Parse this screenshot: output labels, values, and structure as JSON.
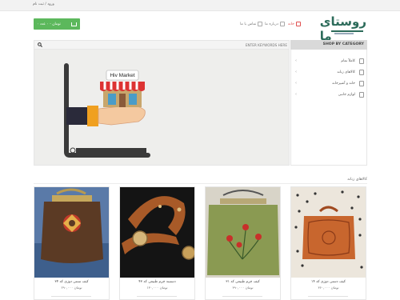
{
  "topbar": {
    "login_text": "ورود / ثبت نام"
  },
  "header": {
    "cart_label": "۰ تومان - ۰ عدد",
    "nav": {
      "home": "خانه",
      "about": "درباره ما",
      "contact": "تماس با ما"
    },
    "logo_text": "روستای ما"
  },
  "search": {
    "placeholder": "ENTER KEYWORDS HERE"
  },
  "categories": {
    "heading": "SHOP BY CATEGORY",
    "items": [
      {
        "label": "کاملاً تمام",
        "icon": "bag-icon"
      },
      {
        "label": "کالاهای زنانه",
        "icon": "dress-icon"
      },
      {
        "label": "خانه و آشپزخانه",
        "icon": "home-icon"
      },
      {
        "label": "لوازم جانبی",
        "icon": "gift-icon"
      }
    ]
  },
  "banner": {
    "sign_text": "Hiv Market"
  },
  "section": {
    "title": "کالاهای زنانه"
  },
  "products": [
    {
      "name": "کیف دستی دوزی کد ۱۴",
      "price": "۳۶۰,۰۰۰ تومان"
    },
    {
      "name": "کیف چرم طبیعی کد ۳۱",
      "price": "۳۹۰,۰۰۰ تومان"
    },
    {
      "name": "دستبند چرم طبیعی کد ۴۳",
      "price": "۱۳۰,۰۰۰ تومان"
    },
    {
      "name": "کیف سنتی دوزی کد ۳۴",
      "price": "۲۹۰,۰۰۰ تومان"
    }
  ],
  "colors": {
    "accent": "#5cb85c",
    "home_red": "#e05050",
    "logo_green": "#2c6b5a"
  }
}
